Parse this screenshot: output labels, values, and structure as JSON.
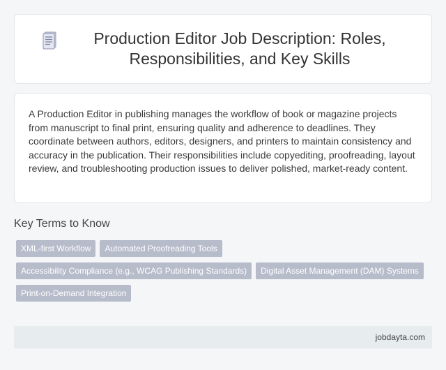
{
  "header": {
    "icon": "document-icon",
    "title": "Production Editor Job Description: Roles, Responsibilities, and Key Skills"
  },
  "description": {
    "text": "A Production Editor in publishing manages the workflow of book or magazine projects from manuscript to final print, ensuring quality and adherence to deadlines. They coordinate between authors, editors, designers, and printers to maintain consistency and accuracy in the publication. Their responsibilities include copyediting, proofreading, layout review, and troubleshooting production issues to deliver polished, market-ready content."
  },
  "key_terms": {
    "heading": "Key Terms to Know",
    "tags": [
      "XML-first Workflow",
      "Automated Proofreading Tools",
      "Accessibility Compliance (e.g., WCAG Publishing Standards)",
      "Digital Asset Management (DAM) Systems",
      "Print-on-Demand Integration"
    ]
  },
  "footer": {
    "site": "jobdayta.com"
  },
  "colors": {
    "background": "#f4f6f8",
    "card": "#ffffff",
    "tag": "#b7bccb",
    "footer": "#e7ecee"
  }
}
